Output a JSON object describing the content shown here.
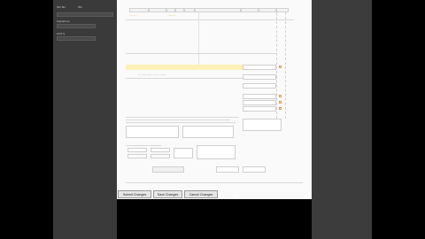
{
  "side": {
    "rows": [
      {
        "label": "Sto No",
        "value": "W1"
      },
      {
        "label": "Signature",
        "value": ""
      },
      {
        "label": "Amt $",
        "value": ""
      }
    ]
  },
  "form": {
    "section_top_label": "",
    "notes_label": "",
    "hl_label": "",
    "hl_label_right": "",
    "signature_label": "",
    "totals": [
      "",
      "",
      "",
      "",
      "",
      ""
    ],
    "modal_button": ""
  },
  "footer": {
    "submit_label": "Submit Changes",
    "save_label": "Save Changes",
    "cancel_label": "Cancel Changes"
  }
}
